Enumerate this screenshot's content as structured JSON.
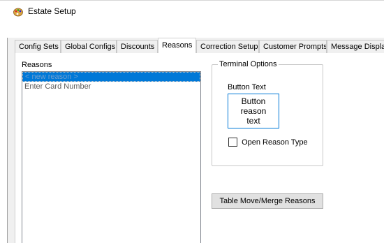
{
  "window": {
    "title": "Estate Setup",
    "icon": "paint-palette-icon"
  },
  "tabs": [
    {
      "label": "Config Sets",
      "active": false
    },
    {
      "label": "Global Configs",
      "active": false
    },
    {
      "label": "Discounts",
      "active": false
    },
    {
      "label": "Reasons",
      "active": true
    },
    {
      "label": "Correction Setup",
      "active": false
    },
    {
      "label": "Customer Prompts",
      "active": false
    },
    {
      "label": "Message Display",
      "active": false
    }
  ],
  "reasons": {
    "label": "Reasons",
    "items": [
      {
        "text": "< new reason >",
        "selected": true
      },
      {
        "text": "Enter Card Number",
        "selected": false
      }
    ]
  },
  "terminal_options": {
    "legend": "Terminal Options",
    "button_text_label": "Button Text",
    "button_text_lines": [
      "Button",
      "reason",
      "text"
    ],
    "open_reason_type_label": "Open Reason Type",
    "open_reason_type_checked": false
  },
  "actions": {
    "table_move_merge_label": "Table Move/Merge Reasons"
  },
  "colors": {
    "selection": "#0078d7",
    "focus_border": "#0078d7",
    "panel_bg": "#f0f0f0"
  }
}
